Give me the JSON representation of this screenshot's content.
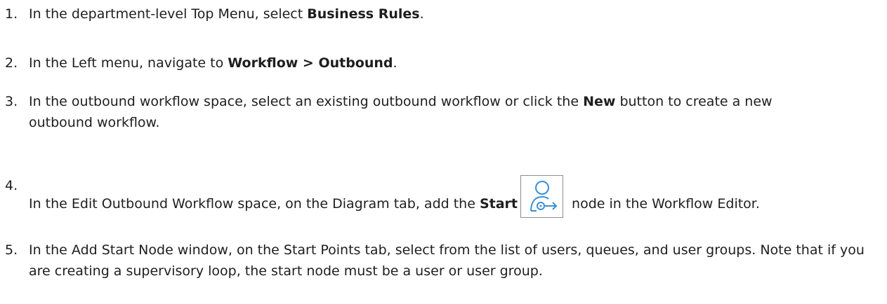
{
  "steps": [
    {
      "num": "1.",
      "parts": [
        "In the department-level Top Menu, select ",
        "Business Rules",
        "."
      ]
    },
    {
      "num": "2.",
      "parts": [
        "In the Left menu, navigate to ",
        "Workflow > Outbound",
        "."
      ]
    },
    {
      "num": "3.",
      "parts": [
        "In the outbound workflow space, select an existing outbound workflow or click the ",
        "New",
        " button to create a new outbound workflow."
      ]
    },
    {
      "num": "4.",
      "parts": [
        "In the Edit Outbound Workflow space, on the Diagram tab, add the ",
        "Start",
        " node in the Workflow Editor."
      ],
      "icon": "start-node-icon"
    },
    {
      "num": "5.",
      "parts": [
        "In the Add Start Node window, on the Start Points tab, select from the list of users, queues, and user groups. Note that if you are creating a supervisory loop, the start node must be a user or user group."
      ]
    }
  ],
  "colors": {
    "text": "#1e1e1e",
    "icon_stroke": "#3a8fd6",
    "icon_border": "#8c8c8c"
  }
}
